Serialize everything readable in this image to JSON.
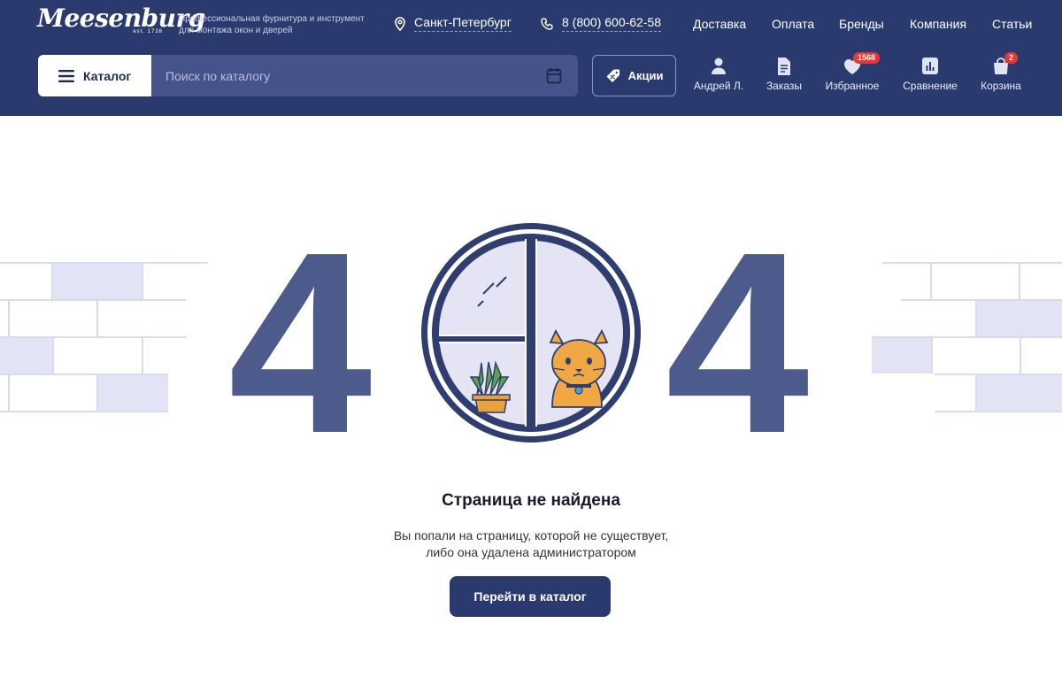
{
  "header": {
    "logo": "Meesenburg",
    "logo_est": "est. 1738",
    "tagline_line1": "Профессиональная фурнитура и инструмент",
    "tagline_line2": "для монтажа окон и дверей",
    "city": "Санкт-Петербург",
    "phone": "8 (800) 600-62-58",
    "nav": [
      "Доставка",
      "Оплата",
      "Бренды",
      "Компания",
      "Статьи"
    ]
  },
  "toolbar": {
    "catalog_label": "Каталог",
    "search_placeholder": "Поиск по каталогу",
    "promo_label": "Акции",
    "user_label": "Андрей Л.",
    "orders_label": "Заказы",
    "favorites_label": "Избранное",
    "favorites_count": "1568",
    "compare_label": "Сравнение",
    "cart_label": "Корзина",
    "cart_count": "2"
  },
  "error": {
    "digit_left": "4",
    "digit_right": "4",
    "title": "Страница не найдена",
    "desc_line1": "Вы попали на страницу, которой не существует,",
    "desc_line2": "либо она удалена администратором",
    "button_label": "Перейти в каталог"
  },
  "colors": {
    "header_bg": "#2b3a6e",
    "digit": "#4d5a8c",
    "badge": "#e53935"
  }
}
